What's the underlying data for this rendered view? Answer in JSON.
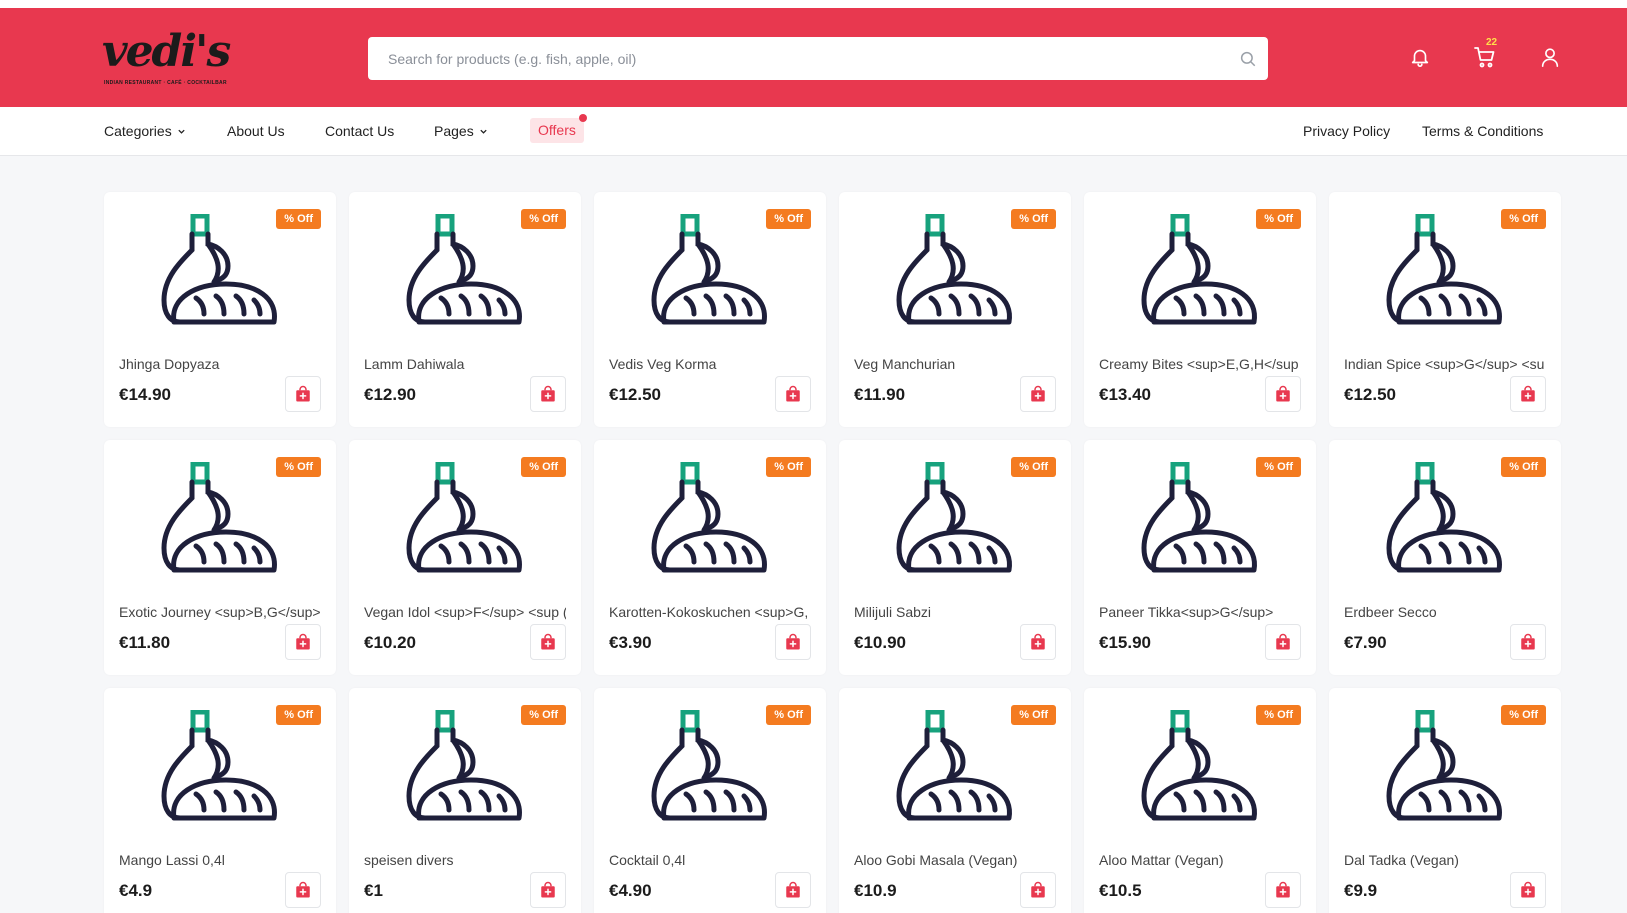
{
  "brand": {
    "logo_text": "vedi's",
    "tagline": "INDIAN RESTAURANT · CAFÉ · COCKTAILBAR"
  },
  "search": {
    "placeholder": "Search for products (e.g. fish, apple, oil)",
    "value": ""
  },
  "header": {
    "cart_count": "22"
  },
  "nav": {
    "categories": "Categories",
    "about": "About Us",
    "contact": "Contact Us",
    "pages": "Pages",
    "offers": "Offers",
    "privacy": "Privacy Policy",
    "terms": "Terms & Conditions"
  },
  "colors": {
    "brand": "#e8384f",
    "badge": "#f47b20",
    "icon_dark": "#1e1f3a",
    "icon_accent": "#17a27d"
  },
  "products": [
    {
      "name": "Jhinga Dopyaza",
      "price": "€14.90",
      "badge": "% Off"
    },
    {
      "name": "Lamm Dahiwala",
      "price": "€12.90",
      "badge": "% Off"
    },
    {
      "name": "Vedis Veg Korma",
      "price": "€12.50",
      "badge": "% Off"
    },
    {
      "name": "Veg Manchurian",
      "price": "€11.90",
      "badge": "% Off"
    },
    {
      "name": "Creamy Bites <sup>E,G,H</sup",
      "price": "€13.40",
      "badge": "% Off"
    },
    {
      "name": "Indian Spice <sup>G</sup> <su",
      "price": "€12.50",
      "badge": "% Off"
    },
    {
      "name": "Exotic Journey <sup>B,G</sup>",
      "price": "€11.80",
      "badge": "% Off"
    },
    {
      "name": "Vegan Idol <sup>F</sup> <sup (",
      "price": "€10.20",
      "badge": "% Off"
    },
    {
      "name": "Karotten-Kokoskuchen <sup>G,",
      "price": "€3.90",
      "badge": "% Off"
    },
    {
      "name": "Milijuli Sabzi",
      "price": "€10.90",
      "badge": "% Off"
    },
    {
      "name": "Paneer Tikka<sup>G</sup>",
      "price": "€15.90",
      "badge": "% Off"
    },
    {
      "name": "Erdbeer Secco",
      "price": "€7.90",
      "badge": "% Off"
    },
    {
      "name": "Mango Lassi 0,4l",
      "price": "€4.9",
      "badge": "% Off"
    },
    {
      "name": "speisen divers",
      "price": "€1",
      "badge": "% Off"
    },
    {
      "name": "Cocktail 0,4l",
      "price": "€4.90",
      "badge": "% Off"
    },
    {
      "name": "Aloo Gobi Masala (Vegan)",
      "price": "€10.9",
      "badge": "% Off"
    },
    {
      "name": "Aloo Mattar (Vegan)",
      "price": "€10.5",
      "badge": "% Off"
    },
    {
      "name": "Dal Tadka (Vegan)",
      "price": "€9.9",
      "badge": "% Off"
    }
  ]
}
